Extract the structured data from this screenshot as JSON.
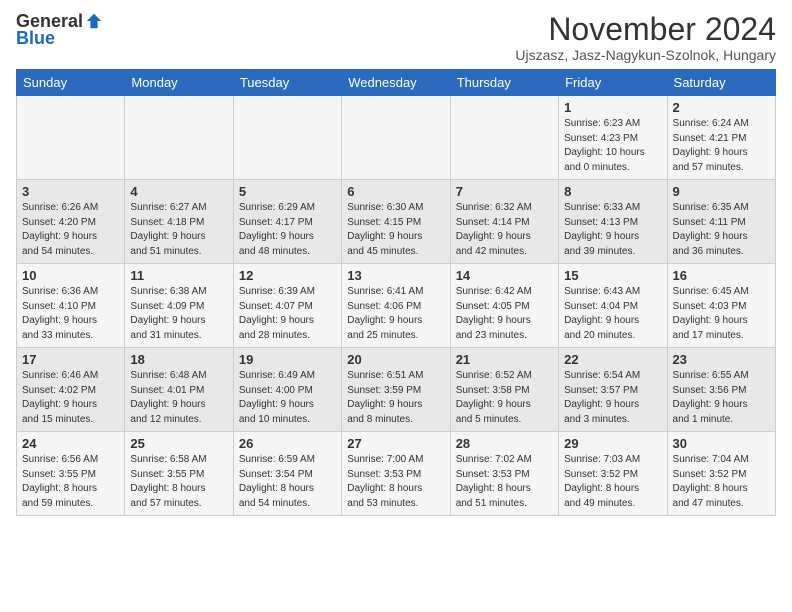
{
  "header": {
    "logo_general": "General",
    "logo_blue": "Blue",
    "month_title": "November 2024",
    "location": "Ujszasz, Jasz-Nagykun-Szolnok, Hungary"
  },
  "weekdays": [
    "Sunday",
    "Monday",
    "Tuesday",
    "Wednesday",
    "Thursday",
    "Friday",
    "Saturday"
  ],
  "weeks": [
    [
      {
        "day": "",
        "info": ""
      },
      {
        "day": "",
        "info": ""
      },
      {
        "day": "",
        "info": ""
      },
      {
        "day": "",
        "info": ""
      },
      {
        "day": "",
        "info": ""
      },
      {
        "day": "1",
        "info": "Sunrise: 6:23 AM\nSunset: 4:23 PM\nDaylight: 10 hours\nand 0 minutes."
      },
      {
        "day": "2",
        "info": "Sunrise: 6:24 AM\nSunset: 4:21 PM\nDaylight: 9 hours\nand 57 minutes."
      }
    ],
    [
      {
        "day": "3",
        "info": "Sunrise: 6:26 AM\nSunset: 4:20 PM\nDaylight: 9 hours\nand 54 minutes."
      },
      {
        "day": "4",
        "info": "Sunrise: 6:27 AM\nSunset: 4:18 PM\nDaylight: 9 hours\nand 51 minutes."
      },
      {
        "day": "5",
        "info": "Sunrise: 6:29 AM\nSunset: 4:17 PM\nDaylight: 9 hours\nand 48 minutes."
      },
      {
        "day": "6",
        "info": "Sunrise: 6:30 AM\nSunset: 4:15 PM\nDaylight: 9 hours\nand 45 minutes."
      },
      {
        "day": "7",
        "info": "Sunrise: 6:32 AM\nSunset: 4:14 PM\nDaylight: 9 hours\nand 42 minutes."
      },
      {
        "day": "8",
        "info": "Sunrise: 6:33 AM\nSunset: 4:13 PM\nDaylight: 9 hours\nand 39 minutes."
      },
      {
        "day": "9",
        "info": "Sunrise: 6:35 AM\nSunset: 4:11 PM\nDaylight: 9 hours\nand 36 minutes."
      }
    ],
    [
      {
        "day": "10",
        "info": "Sunrise: 6:36 AM\nSunset: 4:10 PM\nDaylight: 9 hours\nand 33 minutes."
      },
      {
        "day": "11",
        "info": "Sunrise: 6:38 AM\nSunset: 4:09 PM\nDaylight: 9 hours\nand 31 minutes."
      },
      {
        "day": "12",
        "info": "Sunrise: 6:39 AM\nSunset: 4:07 PM\nDaylight: 9 hours\nand 28 minutes."
      },
      {
        "day": "13",
        "info": "Sunrise: 6:41 AM\nSunset: 4:06 PM\nDaylight: 9 hours\nand 25 minutes."
      },
      {
        "day": "14",
        "info": "Sunrise: 6:42 AM\nSunset: 4:05 PM\nDaylight: 9 hours\nand 23 minutes."
      },
      {
        "day": "15",
        "info": "Sunrise: 6:43 AM\nSunset: 4:04 PM\nDaylight: 9 hours\nand 20 minutes."
      },
      {
        "day": "16",
        "info": "Sunrise: 6:45 AM\nSunset: 4:03 PM\nDaylight: 9 hours\nand 17 minutes."
      }
    ],
    [
      {
        "day": "17",
        "info": "Sunrise: 6:46 AM\nSunset: 4:02 PM\nDaylight: 9 hours\nand 15 minutes."
      },
      {
        "day": "18",
        "info": "Sunrise: 6:48 AM\nSunset: 4:01 PM\nDaylight: 9 hours\nand 12 minutes."
      },
      {
        "day": "19",
        "info": "Sunrise: 6:49 AM\nSunset: 4:00 PM\nDaylight: 9 hours\nand 10 minutes."
      },
      {
        "day": "20",
        "info": "Sunrise: 6:51 AM\nSunset: 3:59 PM\nDaylight: 9 hours\nand 8 minutes."
      },
      {
        "day": "21",
        "info": "Sunrise: 6:52 AM\nSunset: 3:58 PM\nDaylight: 9 hours\nand 5 minutes."
      },
      {
        "day": "22",
        "info": "Sunrise: 6:54 AM\nSunset: 3:57 PM\nDaylight: 9 hours\nand 3 minutes."
      },
      {
        "day": "23",
        "info": "Sunrise: 6:55 AM\nSunset: 3:56 PM\nDaylight: 9 hours\nand 1 minute."
      }
    ],
    [
      {
        "day": "24",
        "info": "Sunrise: 6:56 AM\nSunset: 3:55 PM\nDaylight: 8 hours\nand 59 minutes."
      },
      {
        "day": "25",
        "info": "Sunrise: 6:58 AM\nSunset: 3:55 PM\nDaylight: 8 hours\nand 57 minutes."
      },
      {
        "day": "26",
        "info": "Sunrise: 6:59 AM\nSunset: 3:54 PM\nDaylight: 8 hours\nand 54 minutes."
      },
      {
        "day": "27",
        "info": "Sunrise: 7:00 AM\nSunset: 3:53 PM\nDaylight: 8 hours\nand 53 minutes."
      },
      {
        "day": "28",
        "info": "Sunrise: 7:02 AM\nSunset: 3:53 PM\nDaylight: 8 hours\nand 51 minutes."
      },
      {
        "day": "29",
        "info": "Sunrise: 7:03 AM\nSunset: 3:52 PM\nDaylight: 8 hours\nand 49 minutes."
      },
      {
        "day": "30",
        "info": "Sunrise: 7:04 AM\nSunset: 3:52 PM\nDaylight: 8 hours\nand 47 minutes."
      }
    ]
  ]
}
